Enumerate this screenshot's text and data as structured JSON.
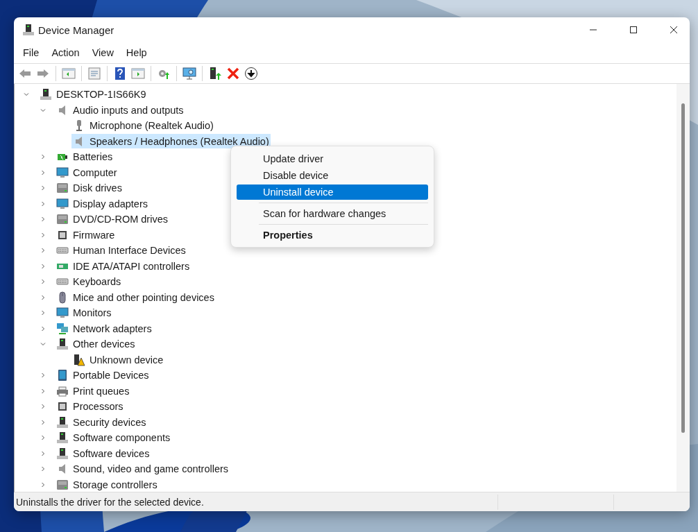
{
  "window": {
    "title": "Device Manager"
  },
  "menu": [
    "File",
    "Action",
    "View",
    "Help"
  ],
  "tree": {
    "label": "DESKTOP-1IS66K9",
    "expanded": true,
    "selected": false,
    "children": [
      {
        "label": "Audio inputs and outputs",
        "expanded": true,
        "selected": false,
        "children": [
          {
            "label": "Microphone (Realtek Audio)",
            "selected": false
          },
          {
            "label": "Speakers / Headphones (Realtek Audio)",
            "selected": true
          }
        ]
      },
      {
        "label": "Batteries",
        "expanded": false,
        "selected": false
      },
      {
        "label": "Computer",
        "expanded": false,
        "selected": false
      },
      {
        "label": "Disk drives",
        "expanded": false,
        "selected": false
      },
      {
        "label": "Display adapters",
        "expanded": false,
        "selected": false
      },
      {
        "label": "DVD/CD-ROM drives",
        "expanded": false,
        "selected": false
      },
      {
        "label": "Firmware",
        "expanded": false,
        "selected": false
      },
      {
        "label": "Human Interface Devices",
        "expanded": false,
        "selected": false
      },
      {
        "label": "IDE ATA/ATAPI controllers",
        "expanded": false,
        "selected": false
      },
      {
        "label": "Keyboards",
        "expanded": false,
        "selected": false
      },
      {
        "label": "Mice and other pointing devices",
        "expanded": false,
        "selected": false
      },
      {
        "label": "Monitors",
        "expanded": false,
        "selected": false
      },
      {
        "label": "Network adapters",
        "expanded": false,
        "selected": false
      },
      {
        "label": "Other devices",
        "expanded": true,
        "selected": false,
        "children": [
          {
            "label": "Unknown device",
            "selected": false
          }
        ]
      },
      {
        "label": "Portable Devices",
        "expanded": false,
        "selected": false
      },
      {
        "label": "Print queues",
        "expanded": false,
        "selected": false
      },
      {
        "label": "Processors",
        "expanded": false,
        "selected": false
      },
      {
        "label": "Security devices",
        "expanded": false,
        "selected": false
      },
      {
        "label": "Software components",
        "expanded": false,
        "selected": false
      },
      {
        "label": "Software devices",
        "expanded": false,
        "selected": false
      },
      {
        "label": "Sound, video and game controllers",
        "expanded": false,
        "selected": false
      },
      {
        "label": "Storage controllers",
        "expanded": false,
        "selected": false
      }
    ]
  },
  "context_menu": [
    {
      "kind": "item",
      "label": "Update driver",
      "selected": false
    },
    {
      "kind": "item",
      "label": "Disable device",
      "selected": false
    },
    {
      "kind": "item",
      "label": "Uninstall device",
      "selected": true
    },
    {
      "kind": "separator"
    },
    {
      "kind": "item",
      "label": "Scan for hardware changes",
      "selected": false
    },
    {
      "kind": "separator"
    },
    {
      "kind": "default",
      "label": "Properties",
      "selected": false
    }
  ],
  "status_bar": {
    "text": "Uninstalls the driver for the selected device."
  }
}
